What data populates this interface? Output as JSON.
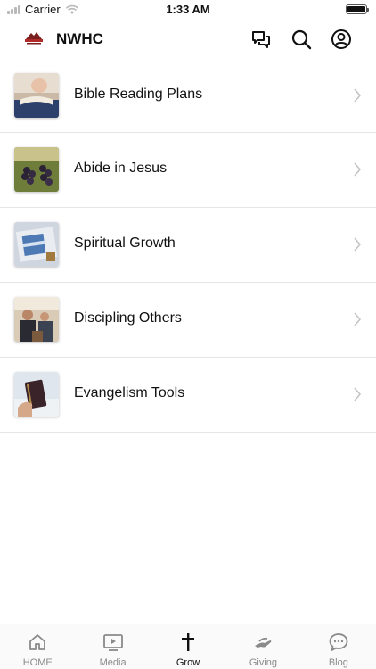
{
  "status_bar": {
    "carrier": "Carrier",
    "time": "1:33 AM"
  },
  "header": {
    "title": "NWHC",
    "logo_icon": "church-logo-icon",
    "actions": [
      {
        "icon": "chat-icon"
      },
      {
        "icon": "search-icon"
      },
      {
        "icon": "account-icon"
      }
    ]
  },
  "list": {
    "items": [
      {
        "label": "Bible Reading Plans",
        "thumbnail": "open-bible-photo"
      },
      {
        "label": "Abide in Jesus",
        "thumbnail": "grapes-photo"
      },
      {
        "label": "Spiritual Growth",
        "thumbnail": "bible-pages-photo"
      },
      {
        "label": "Discipling Others",
        "thumbnail": "people-talking-photo"
      },
      {
        "label": "Evangelism Tools",
        "thumbnail": "hand-holding-bible-photo"
      }
    ]
  },
  "tabbar": {
    "active": "Grow",
    "tabs": [
      {
        "label": "HOME",
        "icon": "home-icon"
      },
      {
        "label": "Media",
        "icon": "play-icon"
      },
      {
        "label": "Grow",
        "icon": "cross-icon"
      },
      {
        "label": "Giving",
        "icon": "giving-hand-icon"
      },
      {
        "label": "Blog",
        "icon": "speech-bubble-icon"
      }
    ]
  },
  "colors": {
    "accent": "#111111",
    "inactive_tab": "#8a8a8a",
    "divider": "#e6e6e6"
  }
}
